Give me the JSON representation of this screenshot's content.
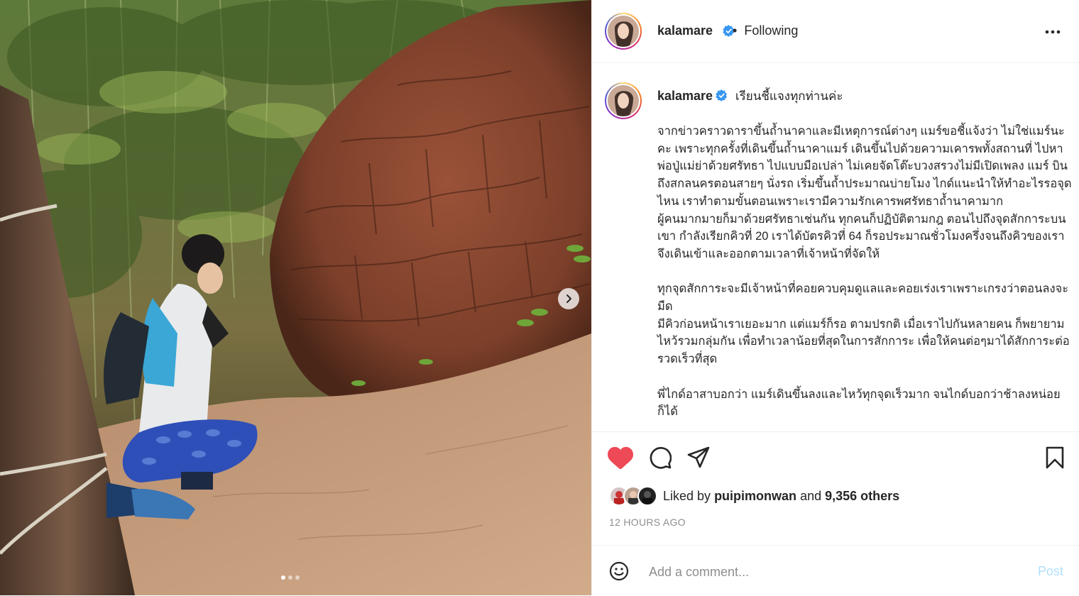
{
  "post": {
    "username": "kalamare",
    "separator": "•",
    "follow_status": "Following",
    "caption_title": "เรียนชี้แจงทุกท่านค่ะ",
    "caption_body": "จากข่าวคราวดาราขึ้นถ้ำนาคาและมีเหตุการณ์ต่างๆ แมร์ขอชี้แจ้งว่า ไม่ใช่แมร์นะคะ เพราะทุกครั้งที่เดินขึ้นถ้ำนาคาแมร์ เดินขึ้นไปด้วยความเคารพทั้งสถานที่ ไปหาพ่อปู่แม่ย่าด้วยศรัทธา ไปแบบมือเปล่า ไม่เคยจัดโต๊ะบวงสรวงไม่มีเปิดเพลง แมร์ บินถึงสกลนครตอนสายๆ นั่งรถ เริ่มขึ้นถ้ำประมาณบ่ายโมง ไกด์แนะนำให้ทำอะไรรอจุดไหน เราทำตามขั้นตอนเพราะเรามีความรักเคารพศรัทธาถ้ำนาคามาก\nผู้คนมากมายก็มาด้วยศรัทธาเช่นกัน ทุกคนก็ปฏิบัติตามกฎ ตอนไปถึงจุดสักการะบนเขา กำลังเรียกคิวที่ 20 เราได้บัตรคิวที่ 64 ก็รอประมาณชั่วโมงครึ่งจนถึงคิวของเรา จึงเดินเข้าและออกตามเวลาที่เจ้าหน้าที่จัดให้\n\nทุกจุดสักการะจะมีเจ้าหน้าที่คอยควบคุมดูแลและคอยเร่งเราเพราะเกรงว่าตอนลงจะมืด\nมีคิวก่อนหน้าเราเยอะมาก แต่แมร์ก็รอ ตามปรกติ เมื่อเราไปกันหลายคน ก็พยายาม ไหว้รวมกลุ่มกัน เพื่อทำเวลาน้อยที่สุดในการสักการะ เพื่อให้คนต่อๆมาได้สักการะต่อรวดเร็วที่สุด\n\nพี่ไกด์อาสาบอกว่า แมร์เดินขึ้นลงและไหว้ทุกจุดเร็วมาก จนไกด์บอกว่าช้าลงหน่อยก็ได้",
    "likes_prefix": "Liked by",
    "liked_by_user": "puipimonwan",
    "likes_and": "and",
    "likes_others": "9,356 others",
    "time_ago": "12 HOURS AGO",
    "comment_placeholder": "Add a comment...",
    "post_label": "Post",
    "carousel": {
      "count": 3,
      "active_index": 0
    }
  },
  "colors": {
    "like_red": "#ed4956",
    "verified_blue": "#3897f0",
    "post_disabled": "#b2dffc",
    "muted": "#8e8e8e"
  },
  "icons": [
    "more-icon",
    "verified-icon",
    "heart-icon",
    "comment-icon",
    "share-icon",
    "save-icon",
    "emoji-icon",
    "chevron-right-icon"
  ]
}
